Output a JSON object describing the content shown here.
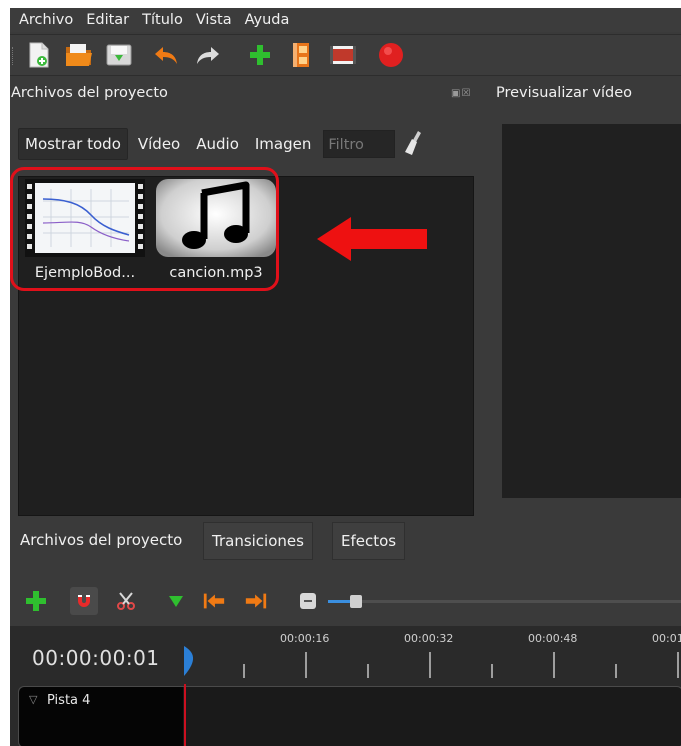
{
  "menu": [
    "Archivo",
    "Editar",
    "Título",
    "Vista",
    "Ayuda"
  ],
  "toolbar": {
    "icons": [
      "new-project-icon",
      "open-project-icon",
      "save-project-icon",
      "undo-icon",
      "redo-icon",
      "import-files-icon",
      "profile-icon",
      "fullscreen-icon",
      "export-video-icon"
    ]
  },
  "project_files": {
    "title": "Archivos del proyecto",
    "dock_buttons": "▣☒",
    "filters": [
      "Mostrar todo",
      "Vídeo",
      "Audio",
      "Imagen"
    ],
    "filter_placeholder": "Filtro",
    "items": [
      {
        "label": "EjemploBod...",
        "type": "video"
      },
      {
        "label": "cancion.mp3",
        "type": "audio"
      }
    ]
  },
  "preview": {
    "title": "Previsualizar vídeo"
  },
  "tabs": [
    "Archivos del proyecto",
    "Transiciones",
    "Efectos"
  ],
  "timeline": {
    "current_time": "00:00:00:01",
    "ticks": [
      "00:00:16",
      "00:00:32",
      "00:00:48",
      "00:01"
    ],
    "track_name": "Pista 4"
  },
  "colors": {
    "highlight": "#e0101a",
    "arrow": "#ee1111",
    "accent_green": "#2fbf2f",
    "accent_orange": "#f07a14",
    "record_red": "#e02020"
  }
}
